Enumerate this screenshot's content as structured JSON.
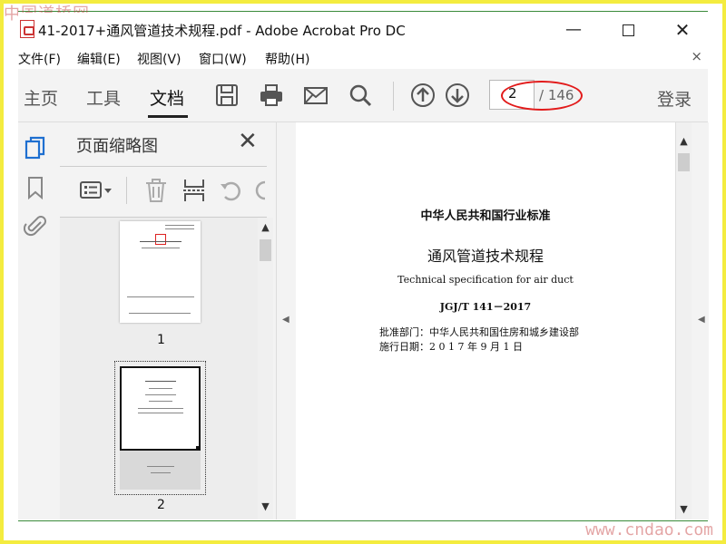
{
  "watermark": {
    "top_left": "中国道桥网",
    "bottom_right": "www.cndao.com"
  },
  "window": {
    "title": "41-2017+通风管道技术规程.pdf - Adobe Acrobat Pro DC",
    "minimize": "—",
    "close": "✕"
  },
  "menu": {
    "items": [
      "文件(F)",
      "编辑(E)",
      "视图(V)",
      "窗口(W)",
      "帮助(H)"
    ],
    "close": "×"
  },
  "toolbar": {
    "tabs": [
      "主页",
      "工具",
      "文档"
    ],
    "active_tab": "文档",
    "icons": [
      "save-icon",
      "print-icon",
      "email-icon",
      "search-icon",
      "page-up-icon",
      "page-down-icon"
    ],
    "page_current": "2",
    "page_total": "/ 146",
    "login": "登录",
    "highlight_color": "#e21b1b"
  },
  "thumbnail_panel": {
    "title": "页面缩略图",
    "close": "✕",
    "thumbnails": [
      {
        "label": "1"
      },
      {
        "label": "2",
        "selected": true
      }
    ]
  },
  "document": {
    "heading": "中华人民共和国行业标准",
    "title": "通风管道技术规程",
    "subtitle": "Technical specification for air duct",
    "code": "JGJ/T 141－2017",
    "approval": "批准部门：中华人民共和国住房和城乡建设部",
    "date": "施行日期：2 0 1 7 年 9 月 1 日"
  },
  "colors": {
    "frame_border": "#f4ec3f",
    "accent_blue": "#1e6fd0",
    "panel_bg": "#f3f3f3"
  }
}
